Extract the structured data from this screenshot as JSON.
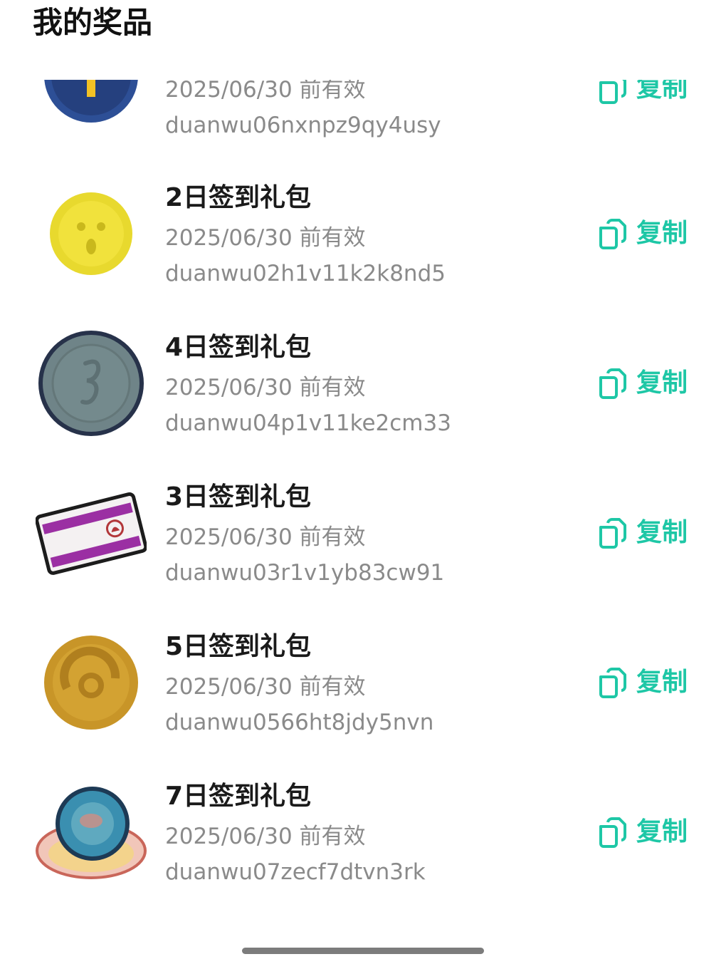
{
  "page_title": "我的奖品",
  "copy_label": "复制",
  "colors": {
    "accent": "#1ec7a6",
    "muted_text": "#8a8a8a",
    "title_text": "#1a1a1a"
  },
  "prizes": [
    {
      "title": "",
      "validity": "2025/06/30 前有效",
      "code": "duanwu06nxnpz9qy4usy",
      "icon": "blue-coin-icon"
    },
    {
      "title": "2日签到礼包",
      "validity": "2025/06/30 前有效",
      "code": "duanwu02h1v11k2k8nd5",
      "icon": "yellow-coin-icon"
    },
    {
      "title": "4日签到礼包",
      "validity": "2025/06/30 前有效",
      "code": "duanwu04p1v11ke2cm33",
      "icon": "gray-coin-icon"
    },
    {
      "title": "3日签到礼包",
      "validity": "2025/06/30 前有效",
      "code": "duanwu03r1v1yb83cw91",
      "icon": "ticket-card-icon"
    },
    {
      "title": "5日签到礼包",
      "validity": "2025/06/30 前有效",
      "code": "duanwu0566ht8jdy5nvn",
      "icon": "gold-coin-icon"
    },
    {
      "title": "7日签到礼包",
      "validity": "2025/06/30 前有效",
      "code": "duanwu07zecf7dtvn3rk",
      "icon": "crystal-orb-icon"
    }
  ]
}
